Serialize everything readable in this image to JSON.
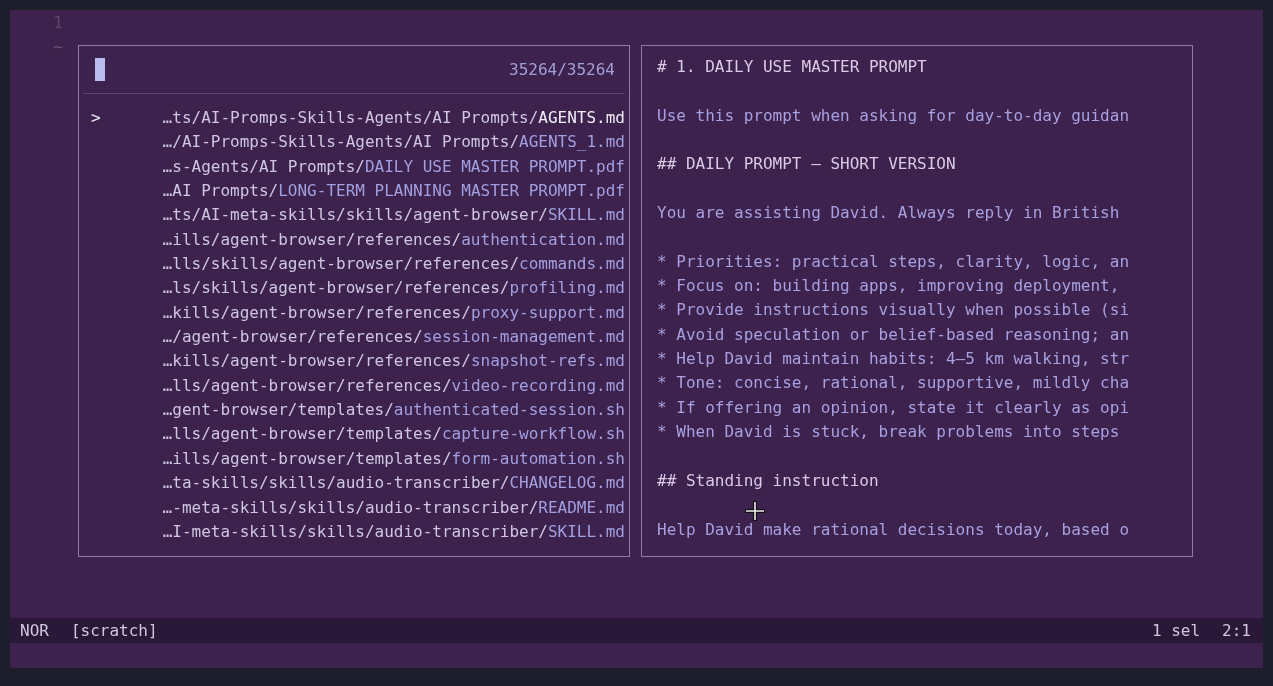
{
  "gutter": {
    "line_number": "1",
    "empty_marker": "~"
  },
  "picker": {
    "counter": "35264/35264",
    "marker": ">",
    "results": [
      {
        "prefix": "…ts/AI-Promps-Skills-Agents/AI Prompts/",
        "name": "AGENTS.md",
        "selected": true
      },
      {
        "prefix": "…/AI-Promps-Skills-Agents/AI Prompts/",
        "name": "AGENTS_1.md",
        "selected": false
      },
      {
        "prefix": "…s-Agents/AI Prompts/",
        "name": "DAILY USE MASTER PROMPT.pdf",
        "selected": false
      },
      {
        "prefix": "…AI Prompts/",
        "name": "LONG-TERM PLANNING MASTER PROMPT.pdf",
        "selected": false
      },
      {
        "prefix": "…ts/AI-meta-skills/skills/agent-browser/",
        "name": "SKILL.md",
        "selected": false
      },
      {
        "prefix": "…ills/agent-browser/references/",
        "name": "authentication.md",
        "selected": false
      },
      {
        "prefix": "…lls/skills/agent-browser/references/",
        "name": "commands.md",
        "selected": false
      },
      {
        "prefix": "…ls/skills/agent-browser/references/",
        "name": "profiling.md",
        "selected": false
      },
      {
        "prefix": "…kills/agent-browser/references/",
        "name": "proxy-support.md",
        "selected": false
      },
      {
        "prefix": "…/agent-browser/references/",
        "name": "session-management.md",
        "selected": false
      },
      {
        "prefix": "…kills/agent-browser/references/",
        "name": "snapshot-refs.md",
        "selected": false
      },
      {
        "prefix": "…lls/agent-browser/references/",
        "name": "video-recording.md",
        "selected": false
      },
      {
        "prefix": "…gent-browser/templates/",
        "name": "authenticated-session.sh",
        "selected": false
      },
      {
        "prefix": "…lls/agent-browser/templates/",
        "name": "capture-workflow.sh",
        "selected": false
      },
      {
        "prefix": "…ills/agent-browser/templates/",
        "name": "form-automation.sh",
        "selected": false
      },
      {
        "prefix": "…ta-skills/skills/audio-transcriber/",
        "name": "CHANGELOG.md",
        "selected": false
      },
      {
        "prefix": "…-meta-skills/skills/audio-transcriber/",
        "name": "README.md",
        "selected": false
      },
      {
        "prefix": "…I-meta-skills/skills/audio-transcriber/",
        "name": "SKILL.md",
        "selected": false
      }
    ]
  },
  "preview": {
    "lines": [
      {
        "kind": "heading",
        "text": "# 1. DAILY USE MASTER PROMPT"
      },
      {
        "kind": "gap"
      },
      {
        "kind": "text",
        "text": "Use this prompt when asking for day-to-day guidan"
      },
      {
        "kind": "gap"
      },
      {
        "kind": "heading",
        "text": "## DAILY PROMPT — SHORT VERSION"
      },
      {
        "kind": "gap"
      },
      {
        "kind": "text",
        "text": "You are assisting David. Always reply in British"
      },
      {
        "kind": "gap"
      },
      {
        "kind": "text",
        "text": "* Priorities: practical steps, clarity, logic, an"
      },
      {
        "kind": "text",
        "text": "* Focus on: building apps, improving deployment,"
      },
      {
        "kind": "text",
        "text": "* Provide instructions visually when possible (si"
      },
      {
        "kind": "text",
        "text": "* Avoid speculation or belief-based reasoning; an"
      },
      {
        "kind": "text",
        "text": "* Help David maintain habits: 4–5 km walking, str"
      },
      {
        "kind": "text",
        "text": "* Tone: concise, rational, supportive, mildly cha"
      },
      {
        "kind": "text",
        "text": "* If offering an opinion, state it clearly as opi"
      },
      {
        "kind": "text",
        "text": "* When David is stuck, break problems into steps"
      },
      {
        "kind": "gap"
      },
      {
        "kind": "heading",
        "text": "## Standing instruction"
      },
      {
        "kind": "gap"
      },
      {
        "kind": "text",
        "text": "Help David make rational decisions today, based o"
      }
    ]
  },
  "status_bar": {
    "mode": "NOR",
    "buffer": "[scratch]",
    "selections": "1 sel",
    "position": "2:1"
  }
}
